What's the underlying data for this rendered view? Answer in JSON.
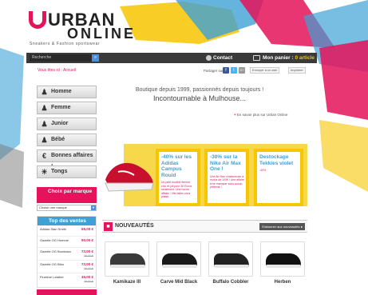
{
  "brand": {
    "name_part1": "URBAN",
    "name_part2": "ONLINE",
    "tagline": "Sneakers & Fashion sportswear"
  },
  "topbar": {
    "search_placeholder": "Recherche",
    "contact": "Contact",
    "cart_label": "Mon panier :",
    "cart_count": "0 article"
  },
  "header": {
    "breadcrumb": "Vous êtes ici : Accueil",
    "share_label": "Partager sur",
    "social": [
      "f",
      "t",
      "G+"
    ],
    "utils": [
      "Envoyer à un ami",
      "Imprimer"
    ]
  },
  "nav": {
    "items": [
      "Homme",
      "Femme",
      "Junior",
      "Bébé",
      "Bonnes affaires !",
      "Tongs"
    ]
  },
  "brand_filter": {
    "title": "Choix par marque",
    "select": "Choisir une marque"
  },
  "top_sales": {
    "title": "Top des ventes",
    "items": [
      {
        "name": "Adidas Stan Smith",
        "price": "65,00 €",
        "old": ""
      },
      {
        "name": "Gazelle OG Homme",
        "price": "90,00 €",
        "old": ""
      },
      {
        "name": "Gazelle OG Bordeaux",
        "price": "72,00 €",
        "old": "90,00 €"
      },
      {
        "name": "Gazelle OG Bleu",
        "price": "72,00 €",
        "old": "90,00 €"
      },
      {
        "name": "Fluxtime Leather",
        "price": "45,00 €",
        "old": "75,00 €"
      }
    ]
  },
  "hero": {
    "line1": "Boutique depuis 1999, passionnés depuis toujours !",
    "line2": "Incontournable à Mulhouse...",
    "learn_more": "En savoir plus sur Urban Online"
  },
  "promos": [
    {
      "title": "-40% sur les Adidas Campus Rouid",
      "desc": "Un petit modèle femme chic et joli pour 30 Euros seulement. Une bonne affaire ! Vite faites vous plaisir."
    },
    {
      "title": "-30% sur la Nike Air Max One !",
      "desc": "Une Air Max chaleureuse à moins de 100€ ! Une affaire à ne manquer sous aucun prétexte !"
    },
    {
      "title": "Destockage Tekkies violet",
      "desc": "-40%"
    }
  ],
  "news": {
    "title": "NOUVEAUTÉS",
    "subscribe": "S'abonner aux nouveautés",
    "products": [
      "Kamikaze III",
      "Carve Mid Black",
      "Buffalo Cobbler",
      "Herben"
    ]
  },
  "colors": {
    "accent": "#e4135b",
    "blue": "#3ea1d6",
    "yellow": "#f7c600",
    "dark": "#3a3a3a"
  }
}
